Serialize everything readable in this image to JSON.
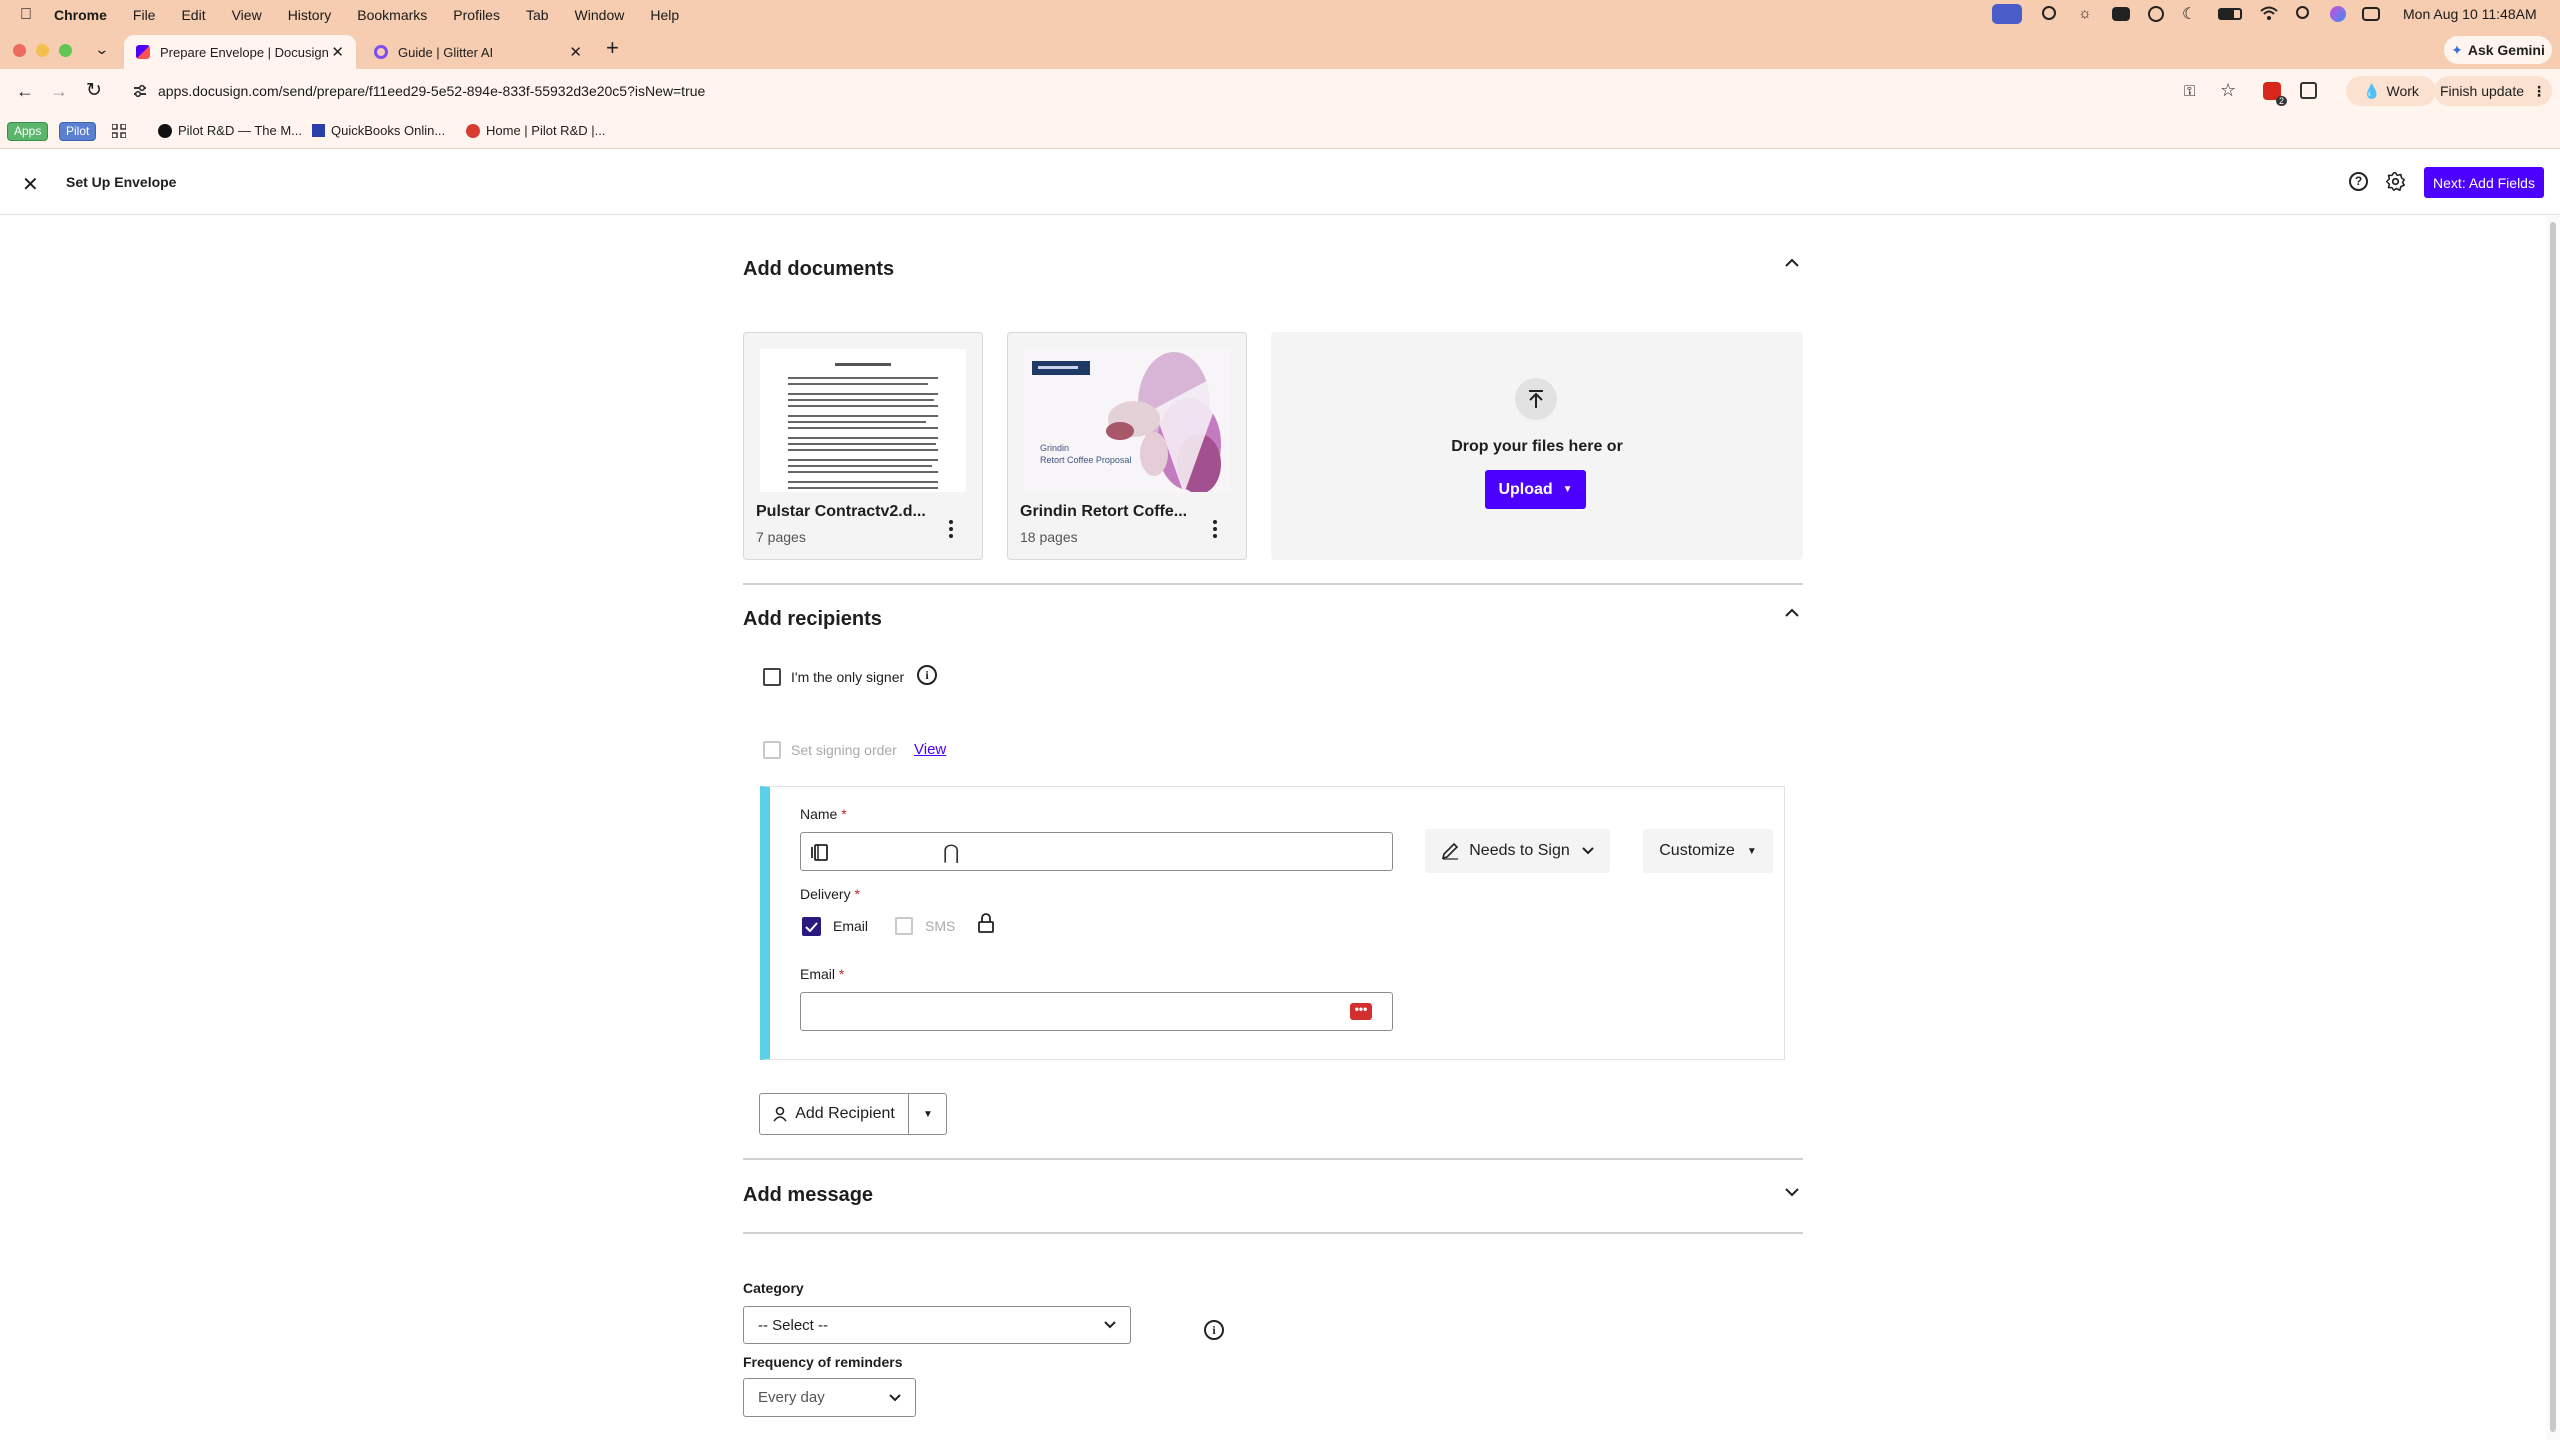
{
  "macos": {
    "menu": [
      "Chrome",
      "File",
      "Edit",
      "View",
      "History",
      "Bookmarks",
      "Profiles",
      "Tab",
      "Window",
      "Help"
    ],
    "clock": "Mon Aug 10  11:48AM",
    "ask_gemini": "Ask Gemini"
  },
  "browser": {
    "tabs": [
      {
        "title": "Prepare Envelope | Docusign",
        "active": true
      },
      {
        "title": "Guide | Glitter AI",
        "active": false
      }
    ],
    "url": "apps.docusign.com/send/prepare/f11eed29-5e52-894e-833f-55932d3e20c5?isNew=true",
    "profile_label": "Work",
    "finish_update": "Finish update",
    "extension_badge": "2",
    "bookmarks": [
      {
        "label": "Apps",
        "type": "tag"
      },
      {
        "label": "Pilot",
        "type": "tag"
      },
      {
        "label": "Pilot R&D — The M...",
        "type": "link"
      },
      {
        "label": "QuickBooks Onlin...",
        "type": "link"
      },
      {
        "label": "Home | Pilot R&D |...",
        "type": "link"
      }
    ]
  },
  "app": {
    "title": "Set Up Envelope",
    "next_button": "Next: Add Fields",
    "accent": "#4c00ff"
  },
  "documents": {
    "heading": "Add documents",
    "files": [
      {
        "name": "Pulstar Contractv2.d...",
        "pages": "7 pages"
      },
      {
        "name": "Grindin Retort Coffe...",
        "pages": "18 pages",
        "thumb_caption": "Grindin\nRetort Coffee Proposal"
      }
    ],
    "drop_text": "Drop your files here or",
    "upload_label": "Upload"
  },
  "recipients": {
    "heading": "Add recipients",
    "only_signer_label": "I'm the only signer",
    "signing_order_label": "Set signing order",
    "view_link": "View",
    "name_label": "Name",
    "name_value": "",
    "delivery_label": "Delivery",
    "email_option": "Email",
    "email_checked": true,
    "sms_option": "SMS",
    "sms_checked": false,
    "email_label": "Email",
    "email_value": "",
    "role": "Needs to Sign",
    "customize": "Customize",
    "add_recipient": "Add Recipient",
    "card_accent": "#5bd0e8"
  },
  "message": {
    "heading": "Add message",
    "category_label": "Category",
    "category_value": "-- Select --",
    "frequency_label": "Frequency of reminders",
    "frequency_value": "Every day"
  }
}
